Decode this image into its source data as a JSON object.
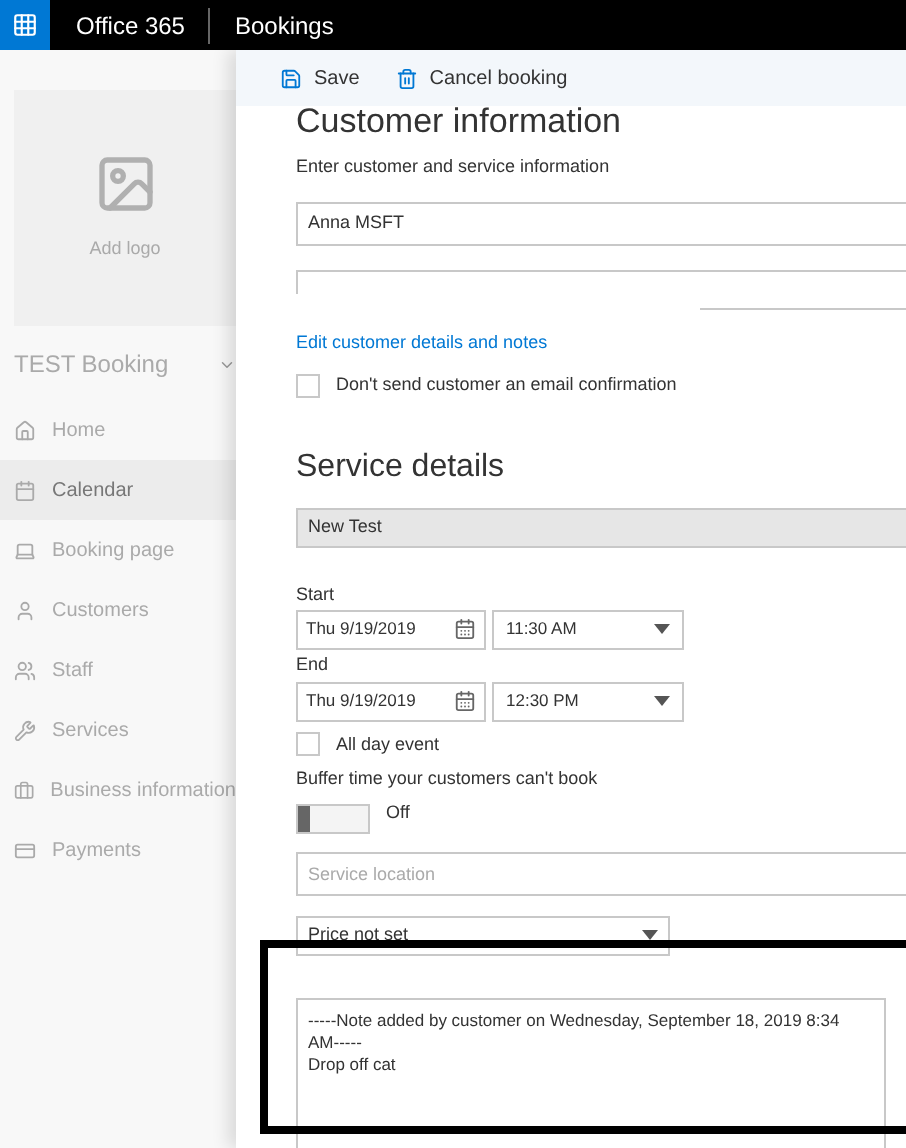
{
  "top_bar": {
    "suite": "Office 365",
    "app": "Bookings"
  },
  "sidebar": {
    "logo_label": "Add logo",
    "business": "TEST Booking",
    "items": [
      {
        "label": "Home",
        "selected": false
      },
      {
        "label": "Calendar",
        "selected": true
      },
      {
        "label": "Booking page",
        "selected": false
      },
      {
        "label": "Customers",
        "selected": false
      },
      {
        "label": "Staff",
        "selected": false
      },
      {
        "label": "Services",
        "selected": false
      },
      {
        "label": "Business information",
        "selected": false
      },
      {
        "label": "Payments",
        "selected": false
      }
    ]
  },
  "toolbar": {
    "save": "Save",
    "cancel": "Cancel booking"
  },
  "customer": {
    "heading": "Customer information",
    "subtitle": "Enter customer and service information",
    "name": "Anna MSFT",
    "edit_link": "Edit customer details and notes",
    "no_email": {
      "label": "Don't send customer an email confirmation",
      "checked": false
    }
  },
  "service": {
    "heading": "Service details",
    "service_name": "New Test",
    "start_label": "Start",
    "start_date": "Thu 9/19/2019",
    "start_time": "11:30 AM",
    "end_label": "End",
    "end_date": "Thu 9/19/2019",
    "end_time": "12:30 PM",
    "all_day": {
      "label": "All day event",
      "checked": false
    },
    "buffer_label": "Buffer time your customers can't book",
    "buffer": {
      "on": false,
      "label": "Off"
    },
    "location_placeholder": "Service location",
    "price": "Price not set",
    "notes": "-----Note added by customer on Wednesday, September 18, 2019 8:34 AM-----\nDrop off cat"
  }
}
